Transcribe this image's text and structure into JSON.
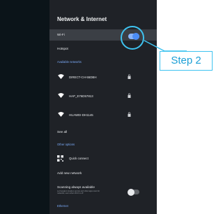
{
  "panel": {
    "title": "Network & Internet",
    "wifi_label": "Wi-Fi",
    "hotspot_label": "Hotspot",
    "available_networks_header": "Available networks",
    "networks": [
      {
        "name": "DIRECT-CH-55DBH",
        "icon": "wifi-icon",
        "locked": true
      },
      {
        "name": "HAP_E76D57813",
        "icon": "wifi-icon",
        "locked": true
      },
      {
        "name": "HUAWEI-DH1145",
        "icon": "wifi-icon",
        "locked": true
      }
    ],
    "see_all_label": "See all",
    "other_options_header": "Other options",
    "quick_connect_label": "Quick connect",
    "add_network_label": "Add new network",
    "scanning_title": "Scanning always available",
    "scanning_desc": "Let Google's location service and other apps scan for networks, even when Wi-Fi is off",
    "ethernet_header": "Ethernet",
    "wifi_toggle": "on",
    "scanning_toggle": "off"
  },
  "callout": {
    "label": "Step 2",
    "color": "#3ec3f0"
  },
  "colors": {
    "panel_bg": "#1f2227",
    "section_header": "#7baaf7",
    "toggle_accent": "#4c8df6"
  }
}
